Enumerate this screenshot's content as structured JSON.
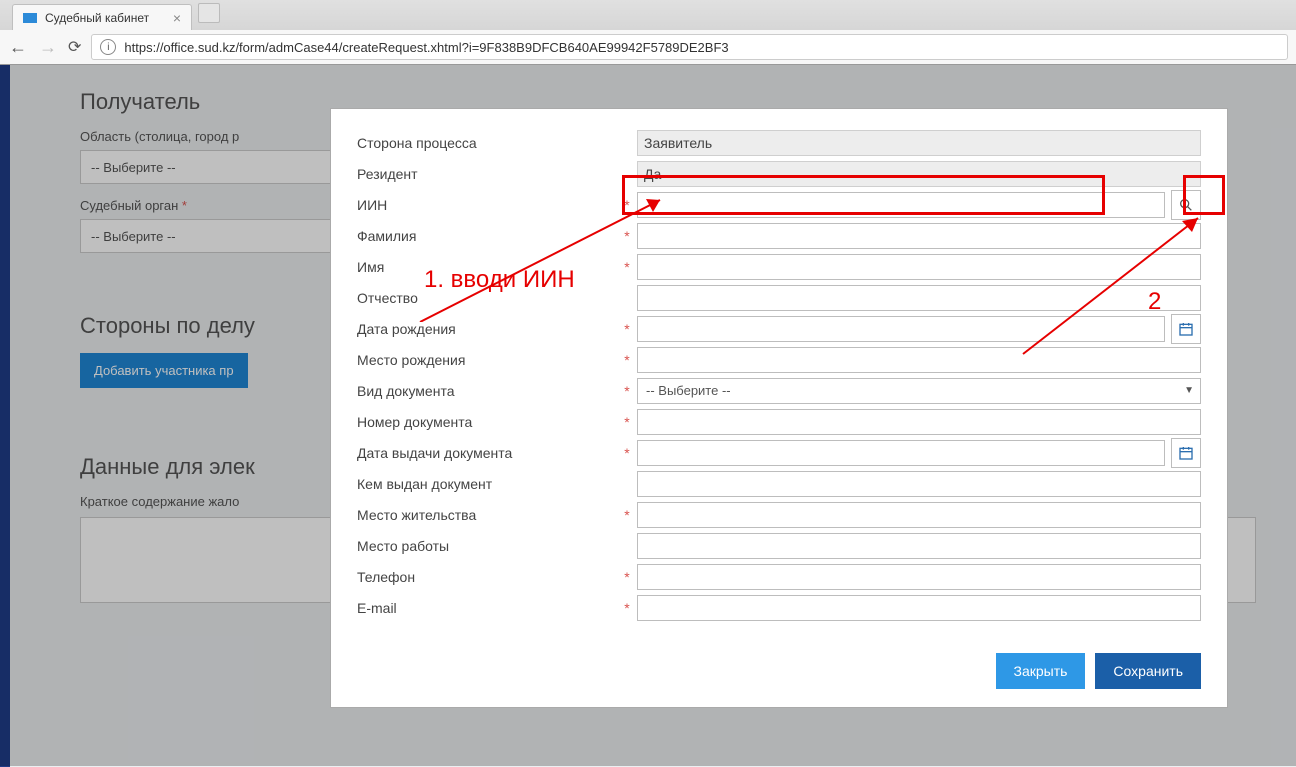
{
  "browser": {
    "tab_title": "Судебный кабинет",
    "url": "https://office.sud.kz/form/admCase44/createRequest.xhtml?i=9F838B9DFCB640AE99942F5789DE2BF3"
  },
  "page": {
    "section_recipient": "Получатель",
    "label_region": "Область (столица, город р",
    "select_placeholder": "-- Выберите --",
    "label_court": "Судебный орган",
    "section_parties": "Стороны по делу",
    "btn_add_participant": "Добавить участника пр",
    "section_electronic": "Данные для элек",
    "label_summary": "Краткое содержание жало"
  },
  "modal": {
    "labels": {
      "side": "Сторона процесса",
      "resident": "Резидент",
      "iin": "ИИН",
      "lastname": "Фамилия",
      "firstname": "Имя",
      "middlename": "Отчество",
      "dob": "Дата рождения",
      "pob": "Место рождения",
      "doc_type": "Вид документа",
      "doc_num": "Номер документа",
      "doc_date": "Дата выдачи документа",
      "doc_issuer": "Кем выдан документ",
      "residence": "Место жительства",
      "work": "Место работы",
      "phone": "Телефон",
      "email": "E-mail"
    },
    "values": {
      "side": "Заявитель",
      "resident": "Да",
      "doc_type": "-- Выберите --"
    },
    "buttons": {
      "close": "Закрыть",
      "save": "Сохранить"
    }
  },
  "annotations": {
    "note1": "1. вводи ИИН",
    "note2": "2"
  }
}
